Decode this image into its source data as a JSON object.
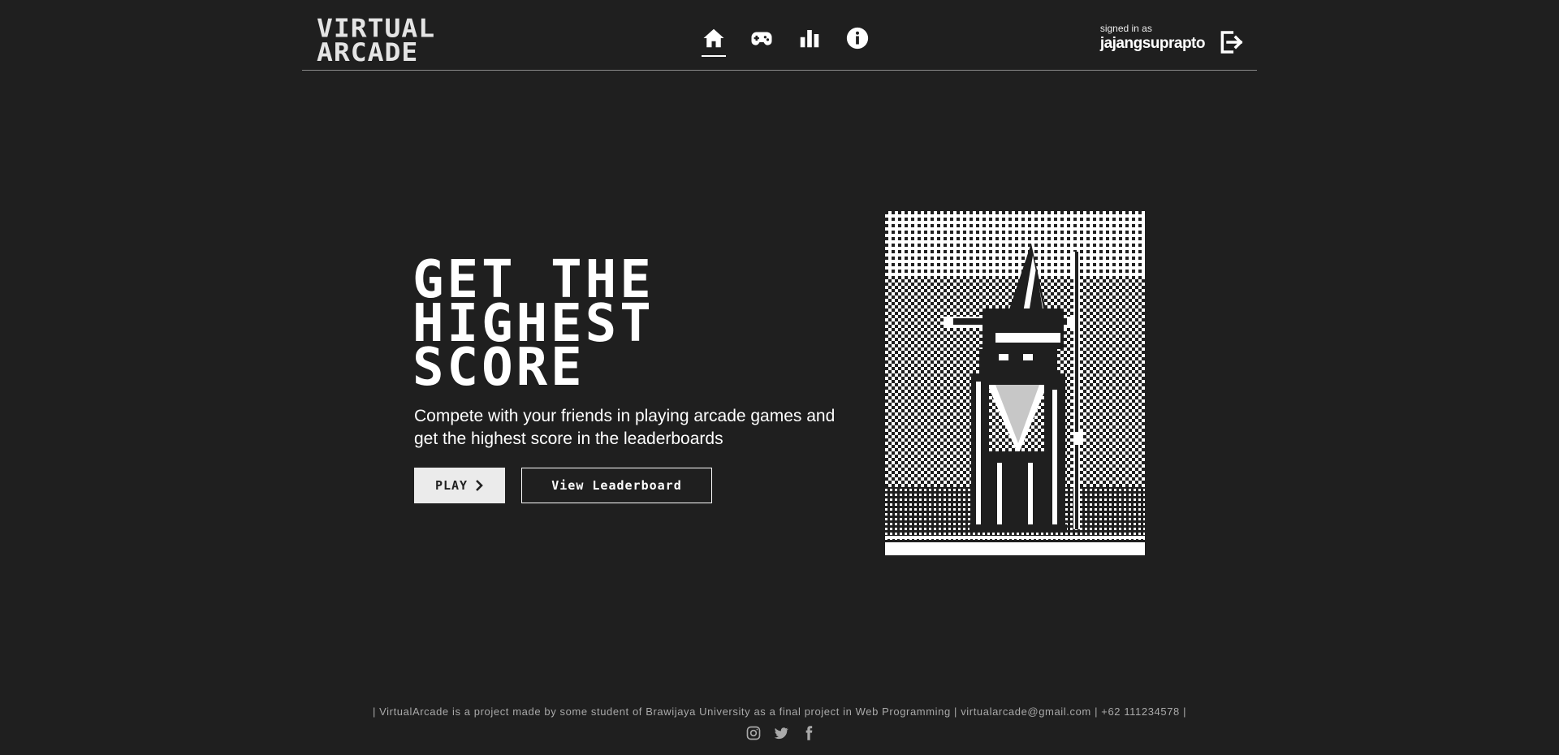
{
  "header": {
    "logo_line1": "VIRTUAL",
    "logo_line2": "ARCADE",
    "nav": [
      {
        "icon": "home-icon",
        "active": true
      },
      {
        "icon": "gamepad-icon",
        "active": false
      },
      {
        "icon": "bar-chart-icon",
        "active": false
      },
      {
        "icon": "info-icon",
        "active": false
      }
    ],
    "signed_in_caption": "signed in as",
    "username": "jajangsuprapto",
    "logout_icon": "logout-icon"
  },
  "hero": {
    "title_line1": "GET THE",
    "title_line2": "HIGHEST",
    "title_line3": "SCORE",
    "subtitle": "Compete with your friends in playing arcade games and get the highest score in the leaderboards",
    "play_label": "PLAY",
    "leaderboard_label": "View Leaderboard",
    "art_icon": "pixel-wizard-art"
  },
  "footer": {
    "text": "| VirtualArcade is a project made by some student of Brawijaya University as a final project in Web Programming | virtualarcade@gmail.com | +62 111234578 |",
    "socials": [
      "instagram-icon",
      "twitter-icon",
      "facebook-icon"
    ]
  },
  "colors": {
    "background": "#1f1f1f",
    "text": "#ffffff",
    "footer_text": "#a9a9a9",
    "button_fill": "#ebebeb"
  }
}
